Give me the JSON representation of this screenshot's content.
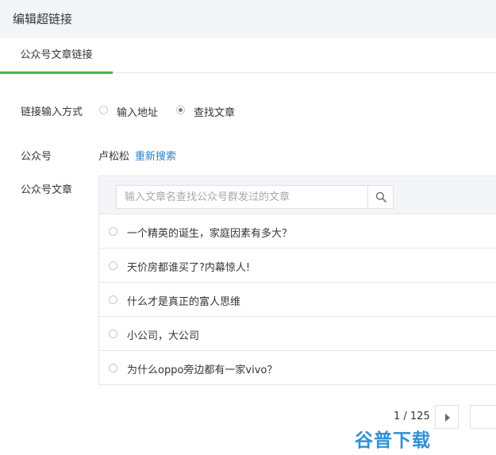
{
  "header": {
    "title": "编辑超链接"
  },
  "tabs": [
    {
      "label": "公众号文章链接",
      "active": true
    }
  ],
  "link_method": {
    "label": "链接输入方式",
    "options": [
      {
        "label": "输入地址",
        "checked": false
      },
      {
        "label": "查找文章",
        "checked": true
      }
    ]
  },
  "account": {
    "label": "公众号",
    "name": "卢松松",
    "research_label": "重新搜索"
  },
  "articles": {
    "label": "公众号文章",
    "search_placeholder": "输入文章名查找公众号群发过的文章",
    "items": [
      {
        "title": "一个精英的诞生，家庭因素有多大？"
      },
      {
        "title": "天价房都谁买了?内幕惊人!"
      },
      {
        "title": "什么才是真正的富人思维"
      },
      {
        "title": "小公司，大公司"
      },
      {
        "title": "为什么oppo旁边都有一家vivo？"
      }
    ]
  },
  "pagination": {
    "text": "1 / 125"
  },
  "watermark": {
    "text": "谷普下载"
  },
  "colors": {
    "accent": "#44b549",
    "link": "#2e7cc2",
    "header_bg": "#f4f5f9",
    "watermark": "#2f8fd6"
  }
}
